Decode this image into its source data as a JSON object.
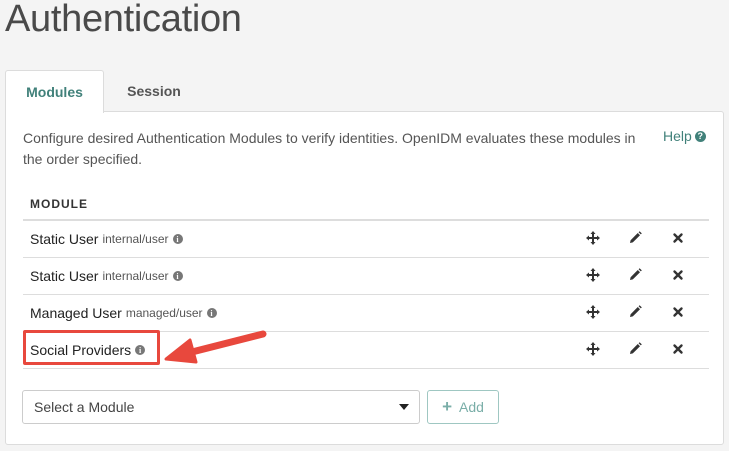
{
  "page": {
    "title": "Authentication"
  },
  "tabs": [
    {
      "label": "Modules",
      "active": true
    },
    {
      "label": "Session",
      "active": false
    }
  ],
  "panel": {
    "description": "Configure desired Authentication Modules to verify identities. OpenIDM evaluates these modules in the order specified.",
    "help_label": "Help"
  },
  "table": {
    "header": "MODULE",
    "rows": [
      {
        "name": "Static User",
        "path": "internal/user"
      },
      {
        "name": "Static User",
        "path": "internal/user"
      },
      {
        "name": "Managed User",
        "path": "managed/user"
      },
      {
        "name": "Social Providers",
        "path": ""
      }
    ]
  },
  "controls": {
    "select_value": "Select a Module",
    "add_label": "Add"
  },
  "colors": {
    "accent": "#41817a",
    "annotation": "#e8483d"
  },
  "icons": {
    "move": "move-arrows-icon",
    "edit": "pencil-icon",
    "delete": "close-icon",
    "info": "info-icon",
    "help": "question-circle-icon"
  }
}
